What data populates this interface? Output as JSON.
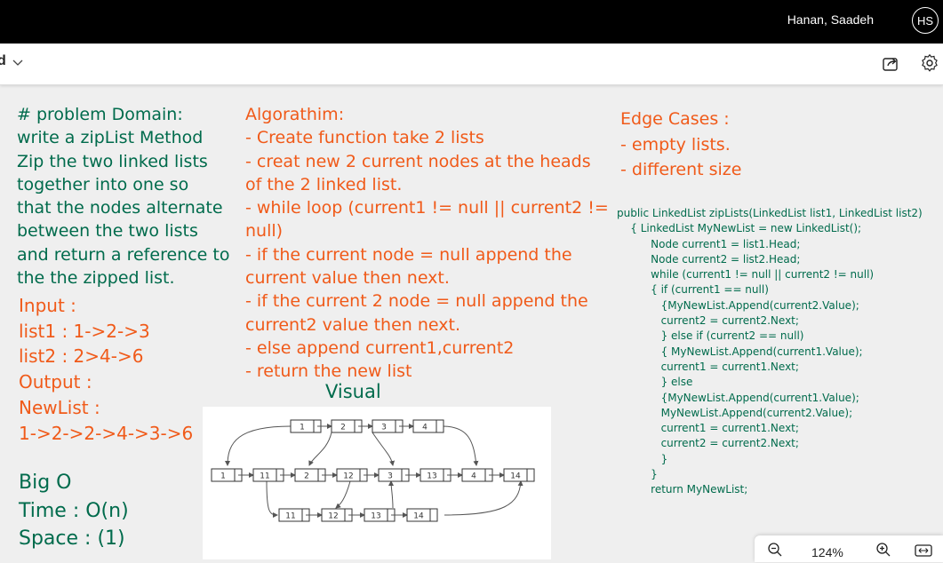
{
  "topbar": {
    "user_name": "Hanan, Saadeh",
    "avatar_initials": "HS"
  },
  "toolbar": {
    "section_fragment": "d",
    "icons": [
      "chevron-down-icon",
      "share-icon",
      "settings-gear-icon"
    ]
  },
  "note": {
    "problem_domain": [
      "# problem Domain:",
      "write a zipList Method",
      "Zip the two linked lists",
      "together into one so",
      "that the nodes alternate",
      "between the two lists",
      "and return a reference to",
      "the the zipped list."
    ],
    "algorithm": [
      "Algorathim:",
      "- Create function take 2 lists",
      "- creat new 2 current nodes at the heads",
      "of the 2 linked list.",
      "- while loop (current1 != null || current2 !=",
      "null)",
      "- if the current node = null append the",
      "current value then next.",
      "- if the current 2 node = null append the",
      "current2 value then next.",
      "- else append current1,current2",
      "- return the new list"
    ],
    "io": [
      "Input :",
      "list1 : 1->2->3",
      "list2 : 2>4->6",
      "Output :",
      "NewList :",
      "1->2->2->4->3->6"
    ],
    "big_o": [
      "Big O",
      "Time : O(n)",
      "Space : (1)"
    ],
    "visual_title": "Visual",
    "edge_cases": [
      "Edge Cases :",
      "- empty lists.",
      "- different size"
    ],
    "code": [
      "public LinkedList zipLists(LinkedList list1, LinkedList list2)",
      "    { LinkedList MyNewList = new LinkedList();",
      "          Node current1 = list1.Head;",
      "          Node current2 = list2.Head;",
      "          while (current1 != null || current2 != null)",
      "          { if (current1 == null)",
      "             {MyNewList.Append(current2.Value);",
      "             current2 = current2.Next;",
      "             } else if (current2 == null)",
      "             { MyNewList.Append(current1.Value);",
      "             current1 = current1.Next;",
      "             } else",
      "             {MyNewList.Append(current1.Value);",
      "             MyNewList.Append(current2.Value);",
      "             current1 = current1.Next;",
      "             current2 = current2.Next;",
      "             }",
      "          }",
      "          return MyNewList;"
    ],
    "diagram": {
      "top_row": [
        "1",
        "2",
        "3",
        "4"
      ],
      "middle_row": [
        "1",
        "11",
        "2",
        "12",
        "3",
        "13",
        "4",
        "14"
      ],
      "bottom_row": [
        "11",
        "12",
        "13",
        "14"
      ]
    }
  },
  "zoom": {
    "level": "124%"
  },
  "colors": {
    "green_ink": "#006b4c",
    "orange_ink": "#f05a19",
    "canvas": "#efefef"
  }
}
